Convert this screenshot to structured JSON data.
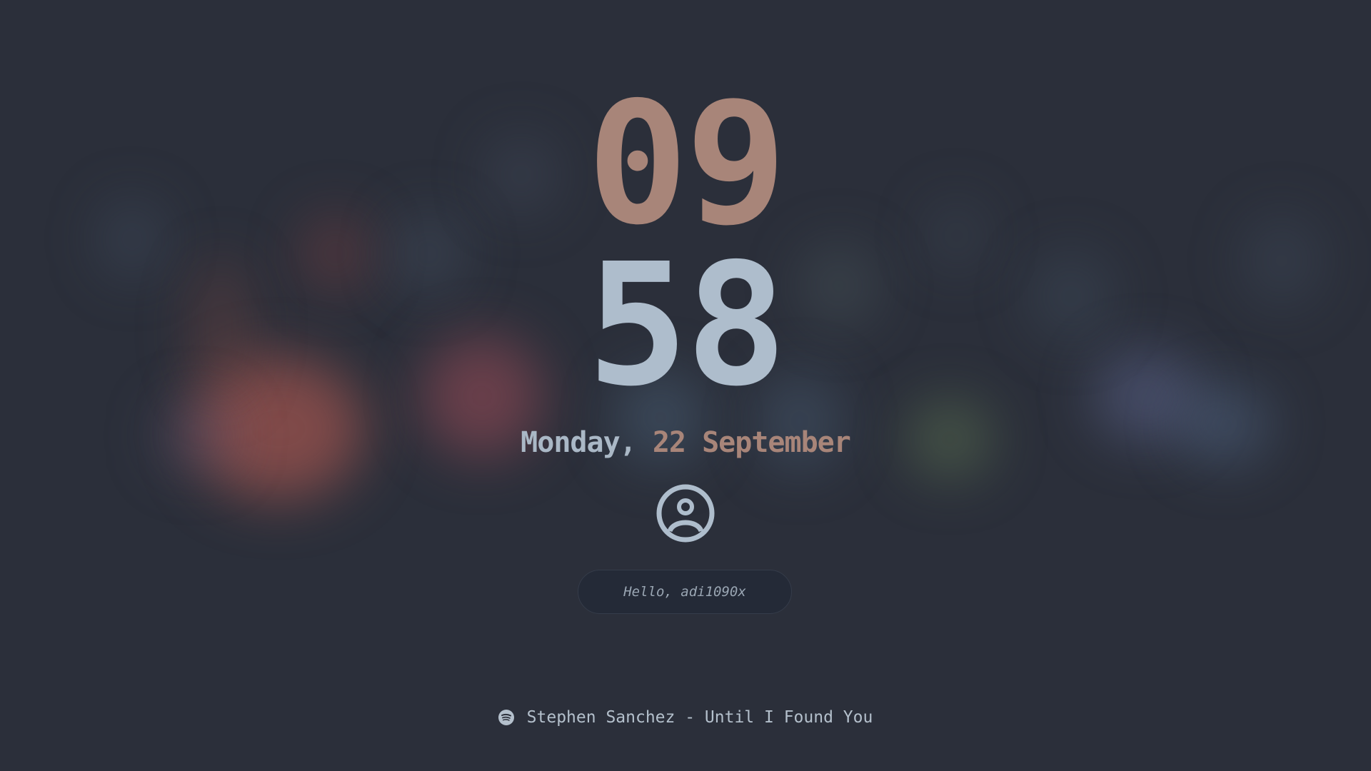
{
  "lockscreen": {
    "clock": {
      "hours": "09",
      "minutes": "58"
    },
    "date": {
      "weekday": "Monday,",
      "day_month": "22 September"
    },
    "greeting": {
      "placeholder": "Hello, adi1090x"
    },
    "now_playing": {
      "text": "Stephen Sanchez - Until I Found You",
      "icon": "spotify-icon"
    },
    "avatar": {
      "icon": "user-avatar-icon"
    }
  },
  "colors": {
    "background": "#2b2f3a",
    "accent_warm": "#a88579",
    "accent_cool": "#aebdcc",
    "input_bg": "#242a37"
  }
}
